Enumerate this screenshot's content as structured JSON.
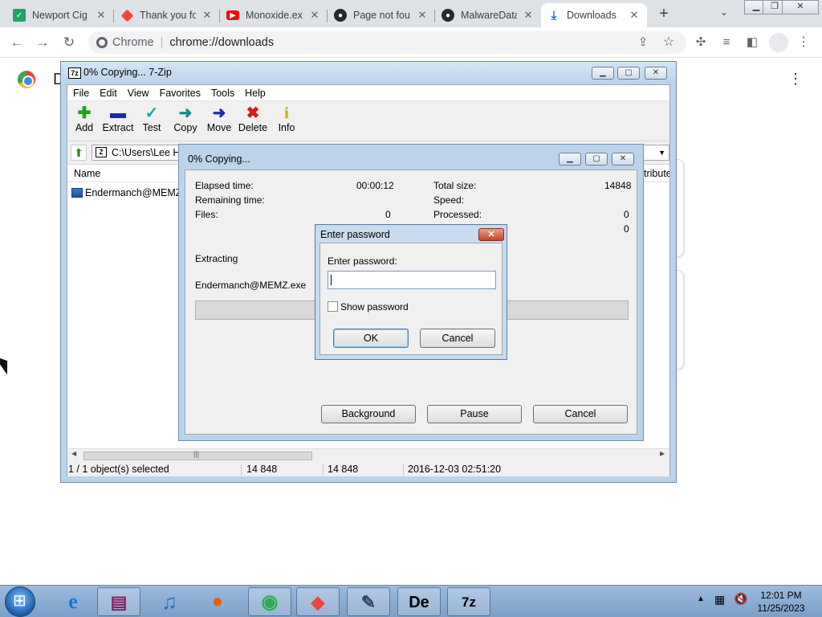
{
  "browser": {
    "tabs": [
      {
        "label": "Newport Cig",
        "icon": "newport-icon",
        "color": "#1fa463"
      },
      {
        "label": "Thank you fo",
        "icon": "anydesk-icon",
        "color": "#ef443b"
      },
      {
        "label": "Monoxide.ex",
        "icon": "youtube-icon",
        "color": "#ff0000"
      },
      {
        "label": "Page not fou",
        "icon": "github-icon",
        "color": "#24292f"
      },
      {
        "label": "MalwareData",
        "icon": "github-icon",
        "color": "#24292f"
      },
      {
        "label": "Downloads",
        "icon": "download-icon",
        "color": "#1a73e8"
      }
    ],
    "tab_close_glyph": "✕",
    "new_tab_glyph": "+",
    "omnibox_chip": "Chrome",
    "url": "chrome://downloads"
  },
  "downloads_page": {
    "title_initial": "D"
  },
  "zip_window": {
    "title": "0% Copying... 7-Zip",
    "logo_text": "7z",
    "menu": [
      "File",
      "Edit",
      "View",
      "Favorites",
      "Tools",
      "Help"
    ],
    "tools": [
      {
        "label": "Add",
        "glyph": "✚",
        "color": "#1ba31b"
      },
      {
        "label": "Extract",
        "glyph": "▬",
        "color": "#1d2aa8"
      },
      {
        "label": "Test",
        "glyph": "✓",
        "color": "#1aa7a7"
      },
      {
        "label": "Copy",
        "glyph": "➜",
        "color": "#1a8a8a"
      },
      {
        "label": "Move",
        "glyph": "➜",
        "color": "#1d2aa8"
      },
      {
        "label": "Delete",
        "glyph": "✖",
        "color": "#d41a1a"
      },
      {
        "label": "Info",
        "glyph": "i",
        "color": "#c7a800"
      }
    ],
    "address": "C:\\Users\\Lee Ha",
    "column_name": "Name",
    "column_attributes": "tribute",
    "row_file": "Endermanch@MEMZ.",
    "status": {
      "selected": "1 / 1 object(s) selected",
      "size": "14 848",
      "packed": "14 848",
      "modified": "2016-12-03 02:51:20"
    }
  },
  "progress_dialog": {
    "title": "0% Copying...",
    "elapsed_label": "Elapsed time:",
    "elapsed_value": "00:00:12",
    "remaining_label": "Remaining time:",
    "files_label": "Files:",
    "files_value": "0",
    "total_size_label": "Total size:",
    "total_size_value": "14848",
    "speed_label": "Speed:",
    "processed_label": "Processed:",
    "processed_value": "0",
    "extra_value": "0",
    "action": "Extracting",
    "current_file": "Endermanch@MEMZ.exe",
    "progress": 0,
    "background_button": "Background",
    "pause_button": "Pause",
    "cancel_button": "Cancel"
  },
  "password_dialog": {
    "title": "Enter password",
    "prompt": "Enter password:",
    "value": "",
    "show_password_label": "Show password",
    "ok_button": "OK",
    "cancel_button": "Cancel"
  },
  "taskbar": {
    "time": "12:01 PM",
    "date": "11/25/2023",
    "apps": [
      {
        "name": "start"
      },
      {
        "name": "internet-explorer-icon",
        "glyph": "e",
        "color": "#1a73d9"
      },
      {
        "name": "winrar-icon",
        "glyph": "▤",
        "color": "#8a1f5a"
      },
      {
        "name": "itunes-icon",
        "glyph": "♫",
        "color": "#2a6bd1"
      },
      {
        "name": "firefox-icon",
        "glyph": "●",
        "color": "#e66000"
      },
      {
        "name": "chrome-icon",
        "glyph": "◉",
        "color": "#34a853"
      },
      {
        "name": "anydesk-icon",
        "glyph": "◆",
        "color": "#ef443b"
      },
      {
        "name": "notepad-icon",
        "glyph": "✎",
        "color": "#334466"
      },
      {
        "name": "dependency-walker-icon",
        "glyph": "De",
        "color": "#000000"
      },
      {
        "name": "sevenzip-icon",
        "glyph": "7z",
        "color": "#000000"
      }
    ]
  }
}
